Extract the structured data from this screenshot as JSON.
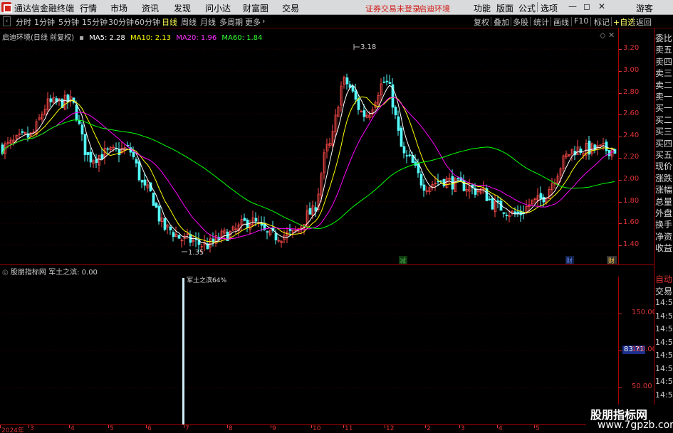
{
  "menubar": {
    "app_title": "通达信金融终端",
    "menu_items": [
      "行情",
      "市场",
      "资讯",
      "发现",
      "问小达",
      "财富圈",
      "交易"
    ],
    "login_status": "证券交易未登录",
    "stock_name": "启迪环境",
    "right_items": [
      "功能",
      "版面",
      "公式",
      "选项"
    ],
    "guest": "游客"
  },
  "toolbar": {
    "timeframes": [
      "分时",
      "1分钟",
      "5分钟",
      "15分钟",
      "30分钟",
      "60分钟",
      "日线",
      "周线",
      "月线",
      "多周期",
      "更多"
    ],
    "active_timeframe": "日线",
    "more_chevron": "›",
    "right_buttons": [
      "复权",
      "叠加",
      "多股",
      "统计",
      "画线",
      "F10",
      "标记",
      "+自选",
      "返回"
    ]
  },
  "chart": {
    "title": "启迪环境(日线 前复权)",
    "ma5": "MA5: 2.28",
    "ma10": "MA10: 2.13",
    "ma20": "MA20: 1.96",
    "ma60": "MA60: 1.84",
    "high_label": "3.18",
    "low_label": "1.35",
    "markers": [
      "减",
      "财",
      "财"
    ],
    "colors": {
      "ma5": "#ffffff",
      "ma10": "#ffff00",
      "ma20": "#ff00ff",
      "ma60": "#00ff00",
      "up": "#ff3333",
      "down": "#54fcfc",
      "axis": "#cc2222",
      "grid": "#550000"
    }
  },
  "chart_data": [
    {
      "type": "candlestick",
      "title": "启迪环境(日线 前复权)",
      "ylim": [
        1.3,
        3.3
      ],
      "yticks": [
        "3.20",
        "3.00",
        "2.80",
        "2.60",
        "2.40",
        "2.20",
        "2.00",
        "1.80",
        "1.60",
        "1.40"
      ],
      "x_months": [
        "2024年",
        "3",
        "4",
        "5",
        "6",
        "7",
        "8",
        "9",
        "10",
        "11",
        "12",
        "2",
        "3",
        "4",
        "5"
      ],
      "close_path": [
        {
          "t": "start",
          "v": 2.3
        },
        {
          "t": "3",
          "v": 2.4
        },
        {
          "t": "mid3",
          "v": 2.7
        },
        {
          "t": "4",
          "v": 2.72
        },
        {
          "t": "mid4",
          "v": 2.2
        },
        {
          "t": "5",
          "v": 2.25
        },
        {
          "t": "mid5",
          "v": 2.28
        },
        {
          "t": "6",
          "v": 1.9
        },
        {
          "t": "mid6",
          "v": 1.55
        },
        {
          "t": "7",
          "v": 1.45
        },
        {
          "t": "mid7",
          "v": 1.4
        },
        {
          "t": "8",
          "v": 1.5
        },
        {
          "t": "mid8",
          "v": 1.62
        },
        {
          "t": "9",
          "v": 1.48
        },
        {
          "t": "mid9",
          "v": 1.5
        },
        {
          "t": "10",
          "v": 1.7
        },
        {
          "t": "mid10",
          "v": 2.3
        },
        {
          "t": "11",
          "v": 2.9
        },
        {
          "t": "mid11",
          "v": 2.6
        },
        {
          "t": "12",
          "v": 2.9
        },
        {
          "t": "mid12",
          "v": 2.2
        },
        {
          "t": "2",
          "v": 1.95
        },
        {
          "t": "mid2",
          "v": 2.0
        },
        {
          "t": "3b",
          "v": 1.95
        },
        {
          "t": "mid3b",
          "v": 1.9
        },
        {
          "t": "4b",
          "v": 1.75
        },
        {
          "t": "mid4b",
          "v": 1.68
        },
        {
          "t": "5b",
          "v": 1.8
        },
        {
          "t": "end",
          "v": 2.28
        }
      ],
      "series": [
        {
          "name": "MA5",
          "value": 2.28
        },
        {
          "name": "MA10",
          "value": 2.13
        },
        {
          "name": "MA20",
          "value": 1.96
        },
        {
          "name": "MA60",
          "value": 1.84
        }
      ],
      "annotations": [
        {
          "text": "3.18",
          "kind": "high"
        },
        {
          "text": "1.35",
          "kind": "low"
        }
      ]
    },
    {
      "type": "bar",
      "title": "股朋指标网 军土之滨: 0.00",
      "ylim": [
        0,
        200
      ],
      "yticks": [
        "150.00",
        "100.00",
        "50.00"
      ],
      "current_value": "83.71",
      "spike_label": "军土之滨64%",
      "spike_month": "7"
    }
  ],
  "sub": {
    "header": "股朋指标网 军土之滨: 0.00",
    "spike_label": "军土之滨64%",
    "current_value": "83.71"
  },
  "right_panel": {
    "labels": [
      "委比",
      "卖五",
      "卖四",
      "卖三",
      "卖二",
      "卖一",
      "买一",
      "买二",
      "买三",
      "买四",
      "买五",
      "现价",
      "涨跌",
      "涨幅",
      "总量",
      "外盘",
      "换手",
      "净资",
      "收益"
    ],
    "auto": "自动",
    "trade": "交易",
    "times": [
      "14:56",
      "14:56",
      "14:56",
      "14:56",
      "14:56",
      "14:56",
      "14:56",
      "14:56",
      "14:56",
      "14:56"
    ]
  },
  "watermark": {
    "line1": "股朋指标网",
    "line2": "www.7gpzb.com"
  }
}
